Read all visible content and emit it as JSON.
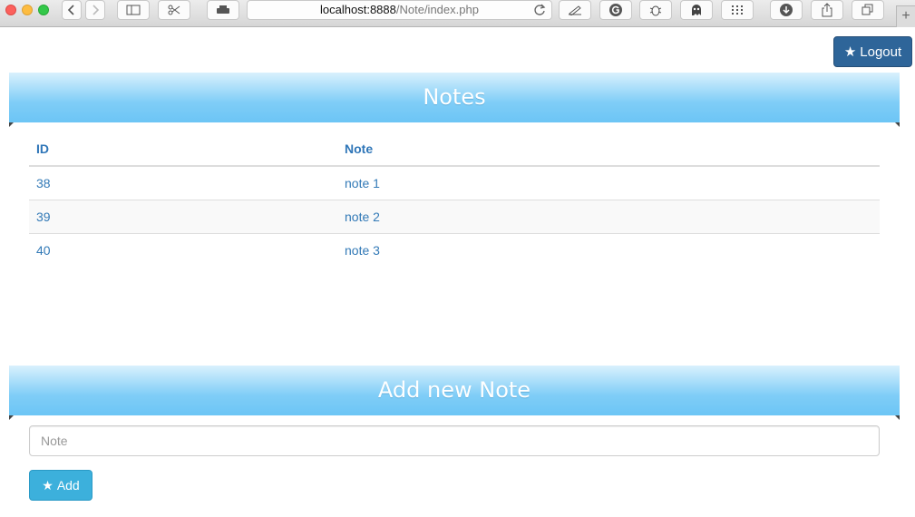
{
  "browser": {
    "url_host": "localhost:8888",
    "url_path": "/Note/index.php",
    "new_tab_label": "+"
  },
  "header": {
    "logout_label": "Logout",
    "star": "★"
  },
  "notes_panel": {
    "title": "Notes",
    "columns": [
      "ID",
      "Note"
    ],
    "rows": [
      {
        "id": "38",
        "note": "note 1"
      },
      {
        "id": "39",
        "note": "note 2"
      },
      {
        "id": "40",
        "note": "note 3"
      }
    ]
  },
  "add_panel": {
    "title": "Add new Note",
    "input_placeholder": "Note",
    "input_value": "",
    "add_label": "Add"
  },
  "colors": {
    "header_gradient_top": "#d9f1fd",
    "header_gradient_bottom": "#6cc5f5",
    "link": "#337ab7",
    "logout_bg": "#2e6599",
    "add_bg": "#3cb0dc"
  }
}
